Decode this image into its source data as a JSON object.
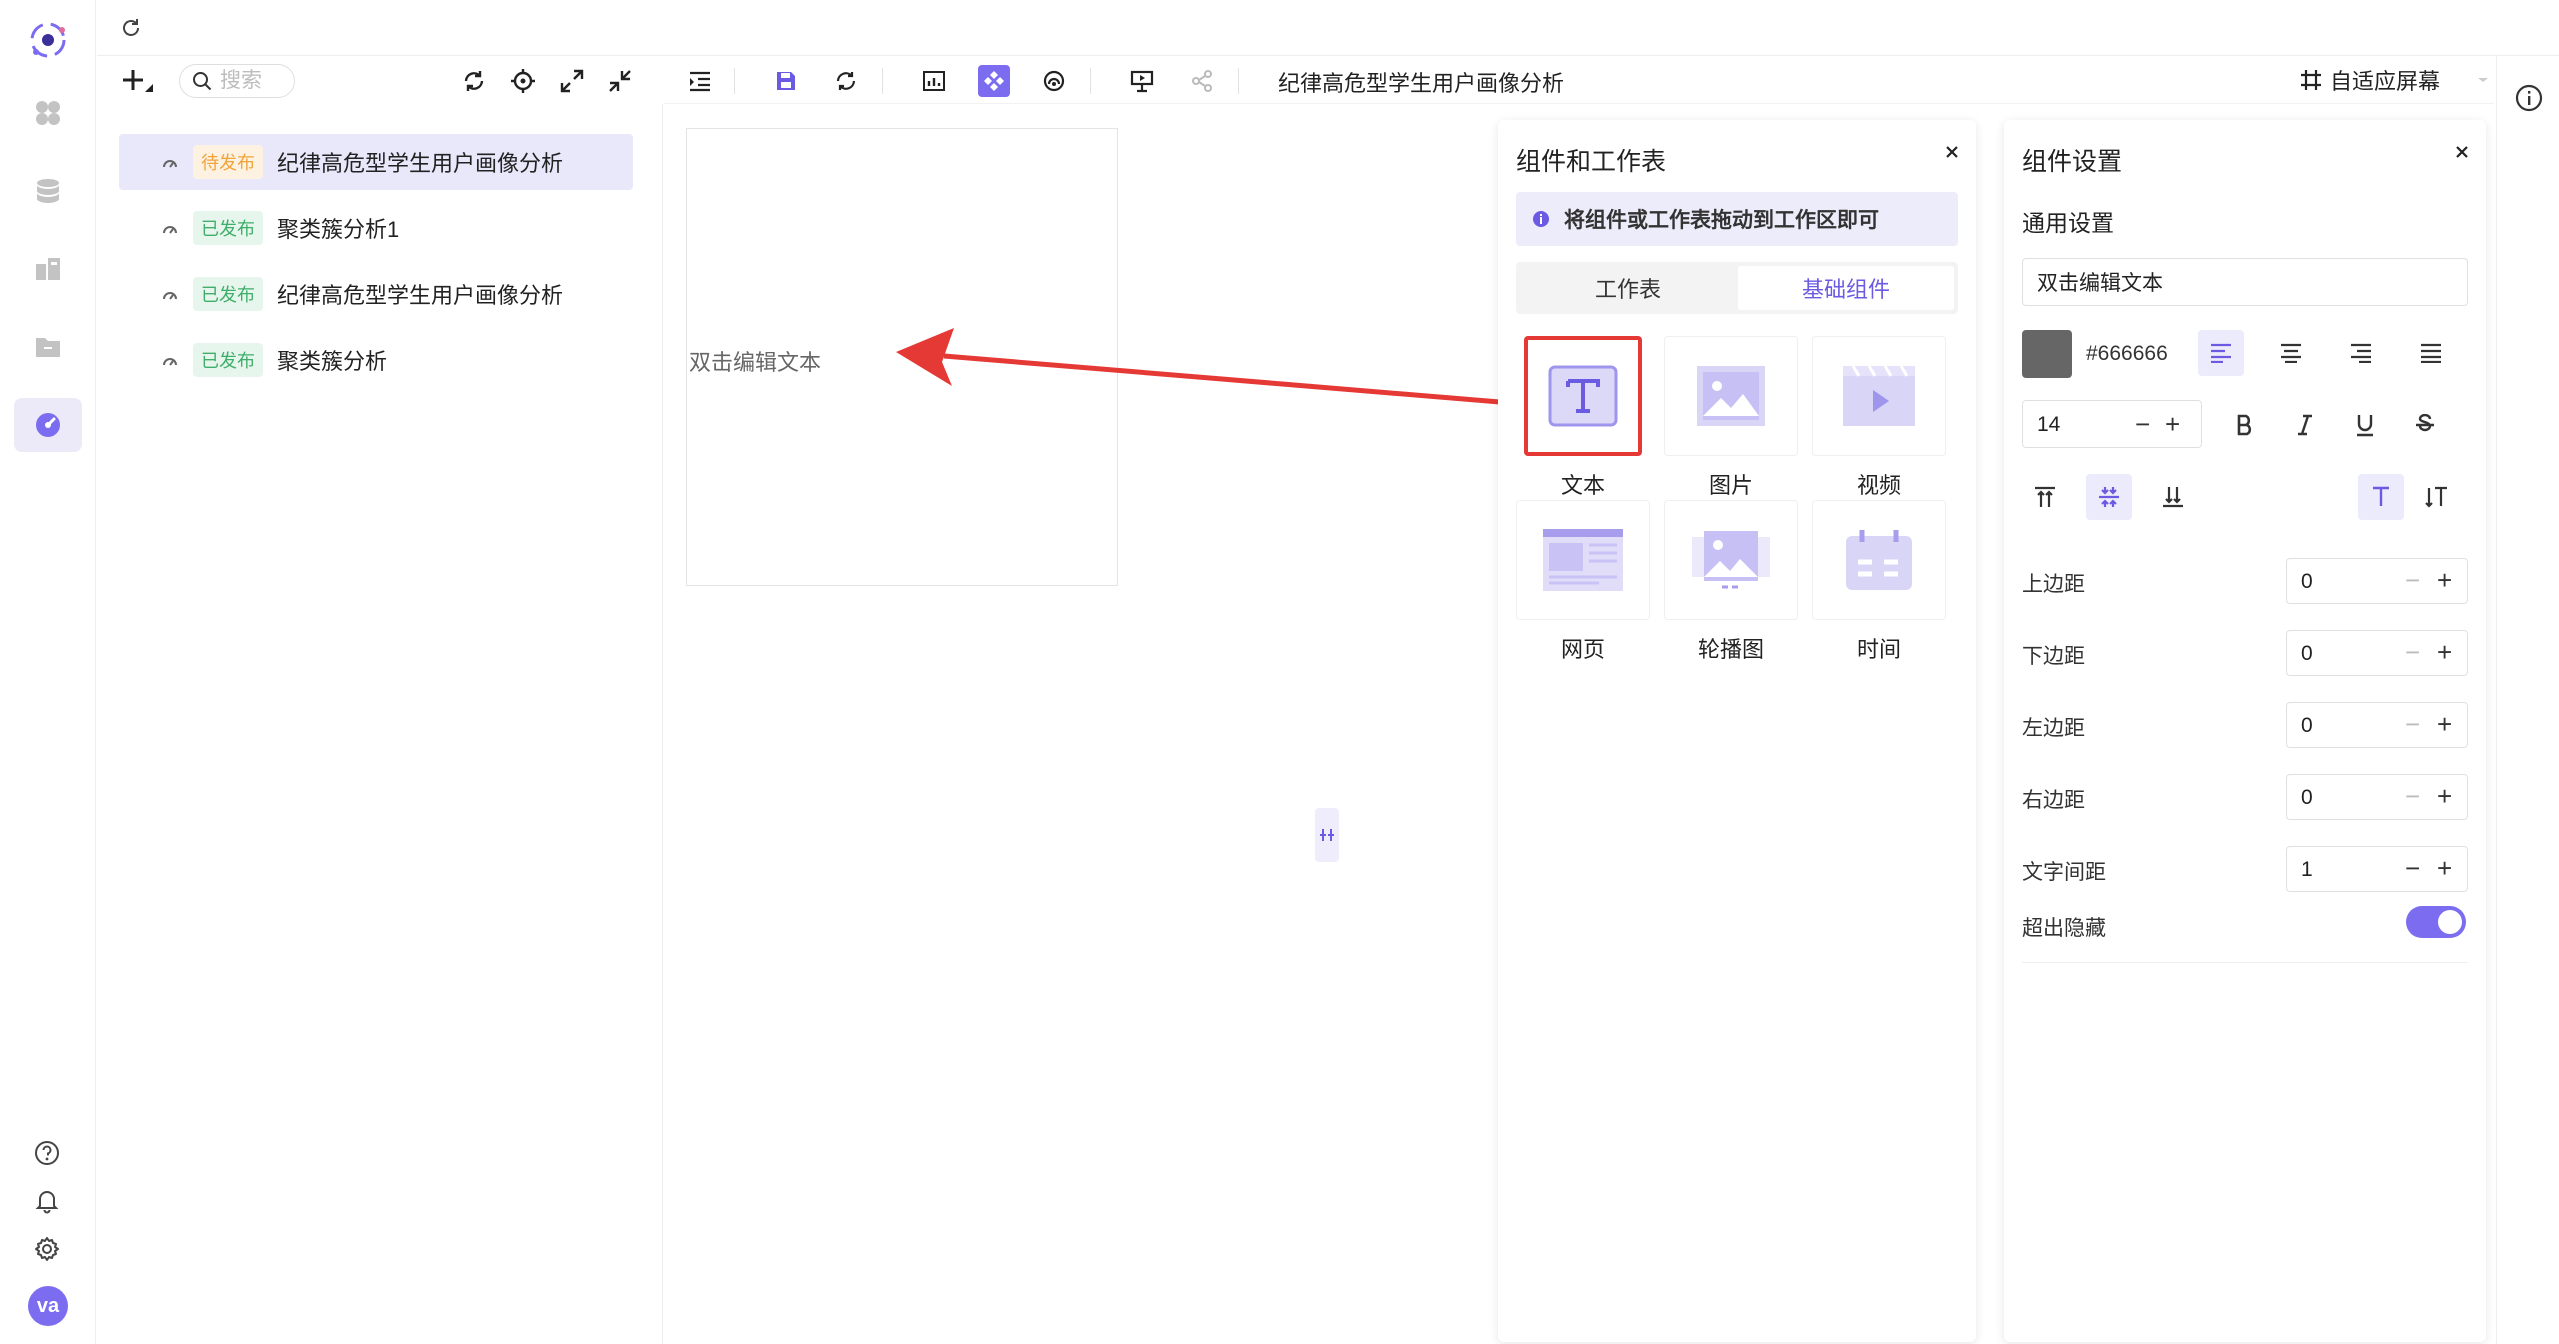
{
  "rail": {
    "items": [
      "logo-icon",
      "apps-icon",
      "database-icon",
      "dashboard-icon",
      "folder-icon",
      "screen-icon"
    ],
    "bottom": [
      "help-icon",
      "bell-icon",
      "settings-icon"
    ],
    "avatar_text": "va",
    "accent": "#7b6cf0"
  },
  "tree": {
    "search_placeholder": "搜索",
    "items": [
      {
        "status": "待发布",
        "name": "纪律高危型学生用户画像分析",
        "state": "pending"
      },
      {
        "status": "已发布",
        "name": "聚类簇分析1",
        "state": "published"
      },
      {
        "status": "已发布",
        "name": "纪律高危型学生用户画像分析",
        "state": "published"
      },
      {
        "status": "已发布",
        "name": "聚类簇分析",
        "state": "published"
      }
    ]
  },
  "toolbar": {
    "doc_title": "纪律高危型学生用户画像分析",
    "fit_screen_label": "自适应屏幕"
  },
  "canvas": {
    "text_widget_content": "双击编辑文本"
  },
  "components_panel": {
    "title": "组件和工作表",
    "hint": "将组件或工作表拖动到工作区即可",
    "tabs": [
      "工作表",
      "基础组件"
    ],
    "active_tab": "基础组件",
    "items": [
      {
        "label": "文本",
        "icon": "text-icon"
      },
      {
        "label": "图片",
        "icon": "image-icon"
      },
      {
        "label": "视频",
        "icon": "video-icon"
      },
      {
        "label": "网页",
        "icon": "webpage-icon"
      },
      {
        "label": "轮播图",
        "icon": "carousel-icon"
      },
      {
        "label": "时间",
        "icon": "calendar-icon"
      }
    ]
  },
  "settings_panel": {
    "title": "组件设置",
    "section": "通用设置",
    "text_value": "双击编辑文本",
    "color_hex": "#666666",
    "font_size": "14",
    "fields": [
      {
        "label": "上边距",
        "value": "0"
      },
      {
        "label": "下边距",
        "value": "0"
      },
      {
        "label": "左边距",
        "value": "0"
      },
      {
        "label": "右边距",
        "value": "0"
      },
      {
        "label": "文字间距",
        "value": "1"
      }
    ],
    "overflow_label": "超出隐藏",
    "overflow_hidden": true
  }
}
